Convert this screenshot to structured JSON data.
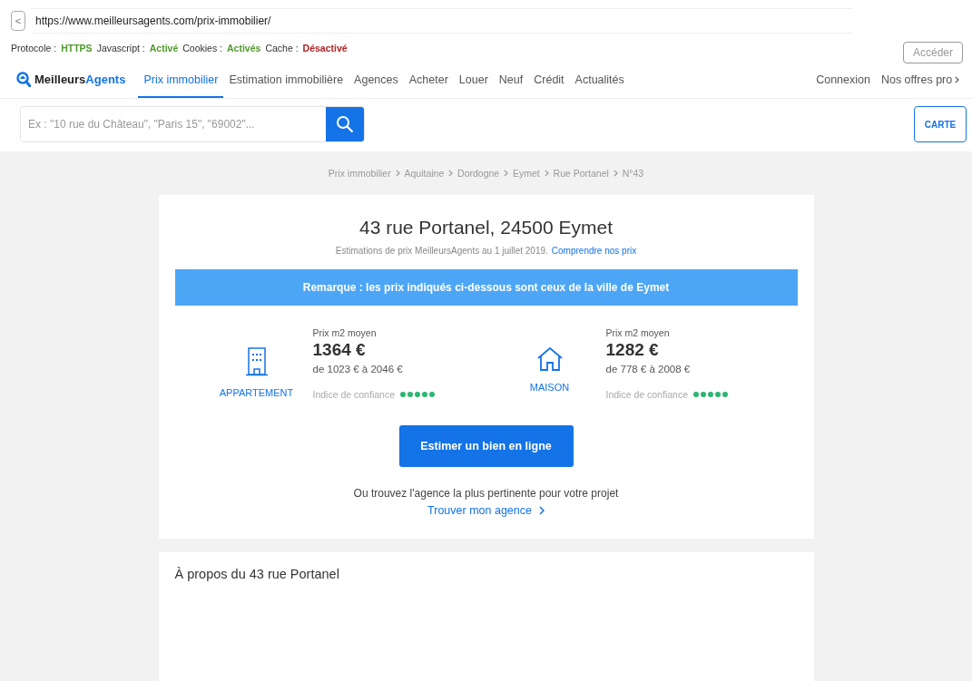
{
  "browser": {
    "back": "<",
    "url": "https://www.meilleursagents.com/prix-immobilier/",
    "go_button": "Accéder"
  },
  "status": [
    {
      "label": "Protocole :",
      "value": "HTTPS",
      "enabled": true
    },
    {
      "label": "Javascript :",
      "value": "Activé",
      "enabled": true
    },
    {
      "label": "Cookies :",
      "value": "Activés",
      "enabled": true
    },
    {
      "label": "Cache :",
      "value": "Désactivé",
      "enabled": false
    }
  ],
  "nav": {
    "logo": {
      "part1": "Meilleurs",
      "part2": "Agents"
    },
    "items": [
      {
        "label": "Prix immobilier",
        "selected": true
      },
      {
        "label": "Estimation immobilière",
        "selected": false
      },
      {
        "label": "Agences",
        "selected": false
      },
      {
        "label": "Acheter",
        "selected": false
      },
      {
        "label": "Louer",
        "selected": false
      },
      {
        "label": "Neuf",
        "selected": false
      },
      {
        "label": "Crédit",
        "selected": false
      },
      {
        "label": "Actualités",
        "selected": false
      }
    ],
    "right": [
      "Connexion",
      "Nos offres pro"
    ]
  },
  "search": {
    "placeholder": "Ex : \"10 rue du Château\", \"Paris 15\", \"69002\"...",
    "map_button": "CARTE"
  },
  "breadcrumb": [
    "Prix immobilier",
    "Aquitaine",
    "Dordogne",
    "Eymet",
    "Rue Portanel",
    "N°43"
  ],
  "card": {
    "title": "43 rue Portanel, 24500 Eymet",
    "subtitle": "Estimations de prix MeilleursAgents au 1 juillet 2019.",
    "subtitle_link": "Comprendre nos prix",
    "notice": "Remarque : les prix indiqués ci-dessous sont ceux de la ville de Eymet",
    "prices": [
      {
        "kind": "apartment",
        "type": "APPARTEMENT",
        "label": "Prix m2 moyen",
        "price": "1364 €",
        "range": "de 1023 € à 2046 €",
        "confidence": "Indice de confiance",
        "stars": 5
      },
      {
        "kind": "house",
        "type": "MAISON",
        "label": "Prix m2 moyen",
        "price": "1282 €",
        "range": "de 778 € à 2008 €",
        "confidence": "Indice de confiance",
        "stars": 5
      }
    ],
    "cta": "Estimer un bien en ligne",
    "agency_text": "Ou trouvez l'agence la plus pertinente pour votre projet",
    "agency_link": "Trouver mon agence"
  },
  "about": {
    "title": "À propos du 43 rue Portanel"
  }
}
